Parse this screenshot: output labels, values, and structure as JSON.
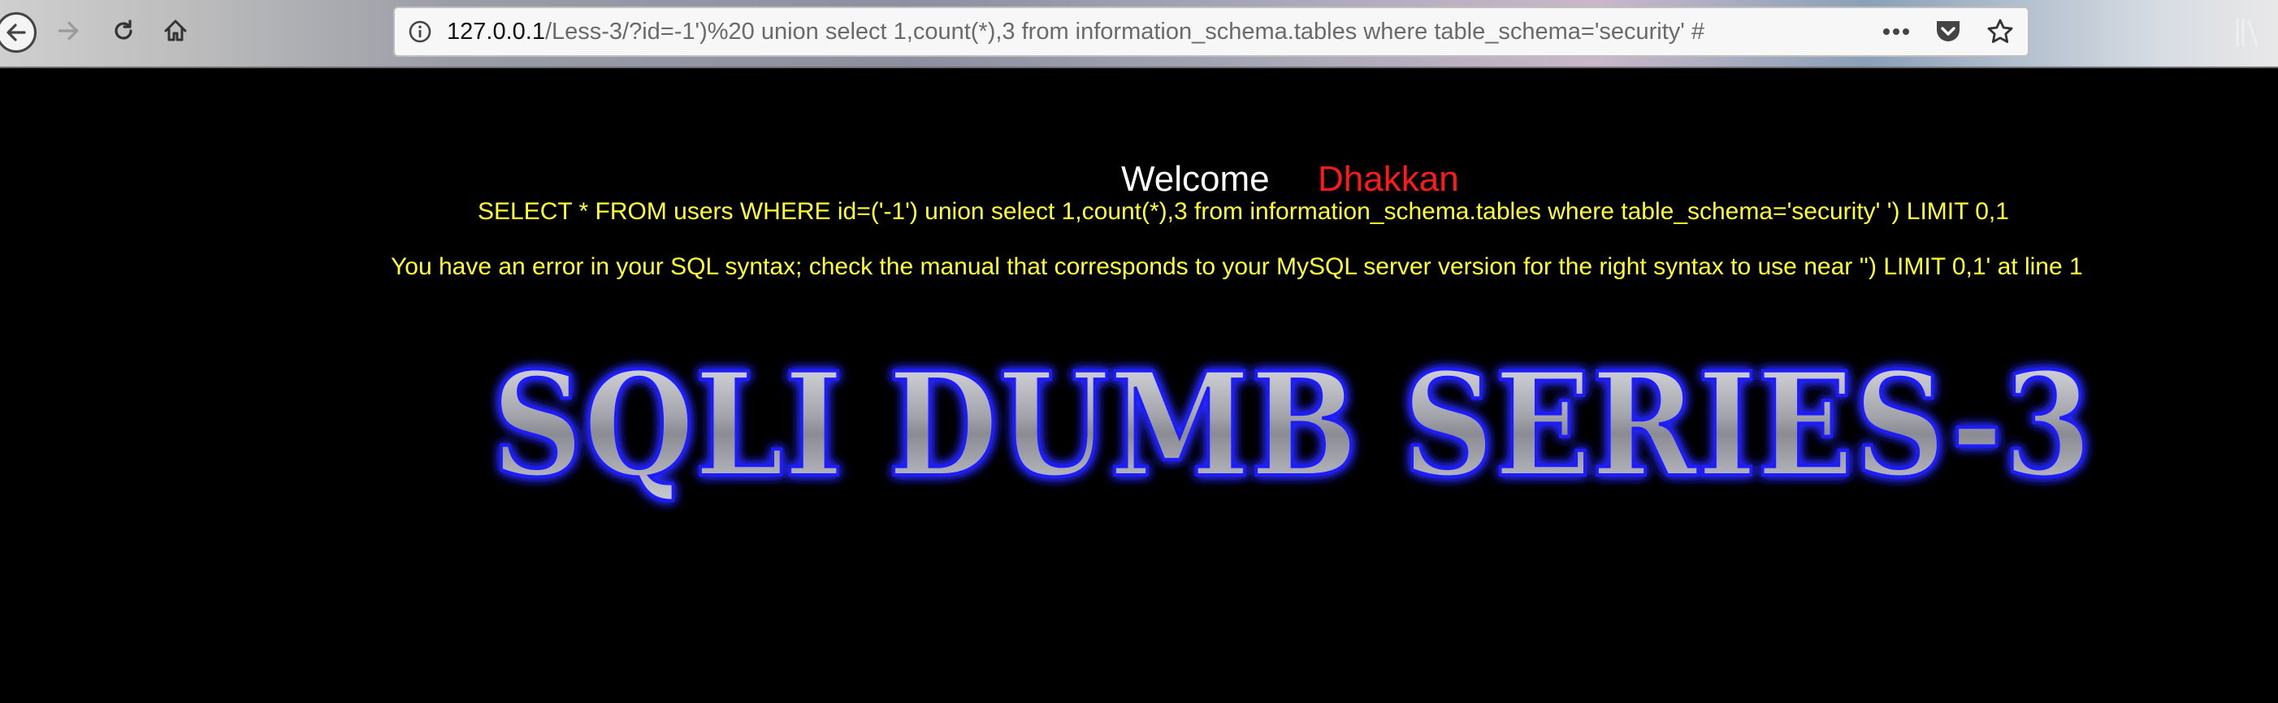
{
  "browser": {
    "url_host": "127.0.0.1",
    "url_path": "/Less-3/?id=-1')%20 union select 1,count(*),3 from information_schema.tables where table_schema='security' #",
    "icons": [
      "back-icon",
      "forward-icon",
      "reload-icon",
      "home-icon",
      "info-icon",
      "more-actions-icon",
      "pocket-icon",
      "bookmark-star-icon",
      "library-icon"
    ]
  },
  "page": {
    "welcome": "Welcome",
    "username": "Dhakkan",
    "query": "SELECT * FROM users WHERE id=('-1') union select 1,count(*),3 from information_schema.tables where table_schema='security' ') LIMIT 0,1",
    "error": "You have an error in your SQL syntax; check the manual that corresponds to your MySQL server version for the right syntax to use near '') LIMIT 0,1' at line 1",
    "banner": "SQLI DUMB SERIES-3",
    "colors": {
      "welcome": "#ffffff",
      "username": "#ff1a1a",
      "message": "#ffff2e",
      "background": "#000000"
    }
  }
}
